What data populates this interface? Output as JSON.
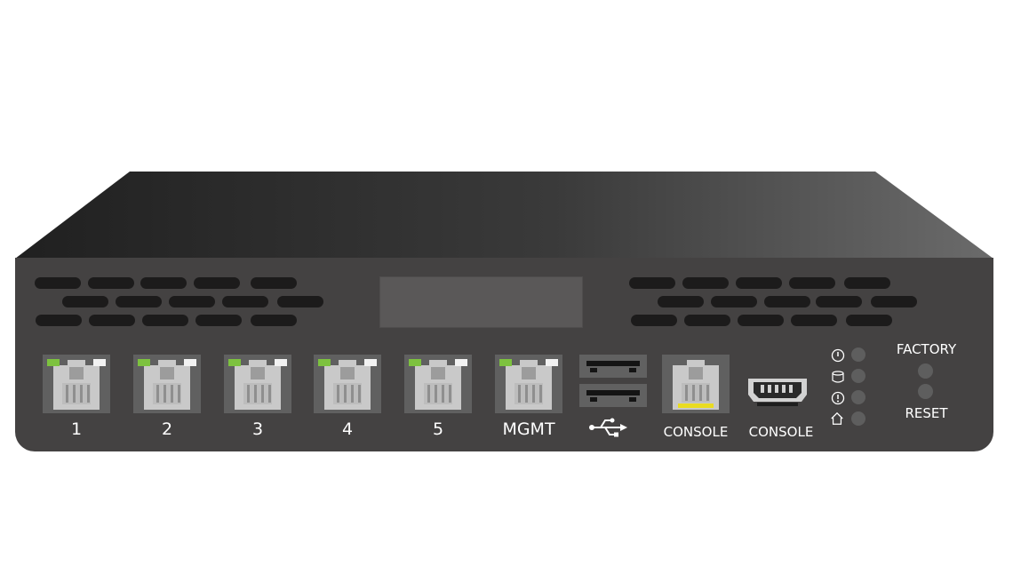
{
  "ports": {
    "ethernet": [
      {
        "label": "1"
      },
      {
        "label": "2"
      },
      {
        "label": "3"
      },
      {
        "label": "4"
      },
      {
        "label": "5"
      },
      {
        "label": "MGMT"
      }
    ],
    "console_rj45_label": "CONSOLE",
    "console_usb_label": "CONSOLE",
    "usb_icon": "usb-icon"
  },
  "status_leds": [
    {
      "icon": "power-icon"
    },
    {
      "icon": "storage-icon"
    },
    {
      "icon": "alert-icon"
    },
    {
      "icon": "home-icon"
    }
  ],
  "buttons": {
    "factory_label": "FACTORY",
    "reset_label": "RESET"
  },
  "colors": {
    "chassis_front": "#444242",
    "link_led": "#7dc23f",
    "activity_led": "#f2f2f2",
    "console_led": "#e9dc21"
  }
}
